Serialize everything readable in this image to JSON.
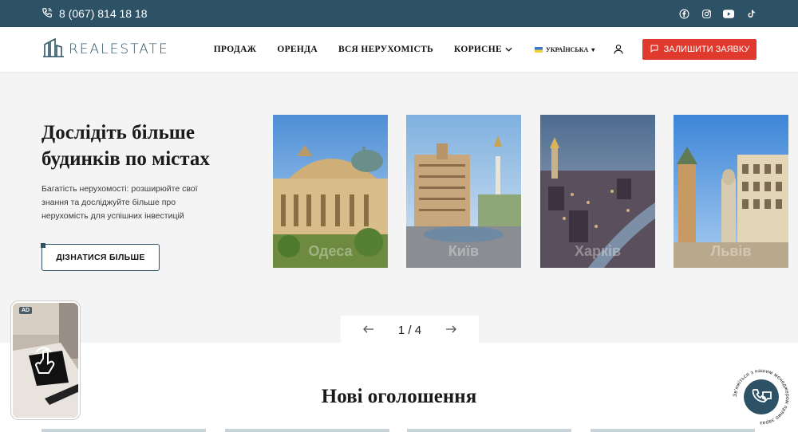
{
  "topbar": {
    "phone": "8 (067) 814 18 18",
    "socials": [
      "facebook-icon",
      "instagram-icon",
      "youtube-icon",
      "tiktok-icon"
    ]
  },
  "header": {
    "logo_text": "REALESTATE",
    "nav": [
      {
        "label": "ПРОДАЖ"
      },
      {
        "label": "ОРЕНДА"
      },
      {
        "label": "ВСЯ НЕРУХОМІСТЬ"
      },
      {
        "label": "КОРИСНЕ"
      }
    ],
    "language": "УКРАЇНСЬКА",
    "cta_label": "ЗАЛИШИТИ ЗАЯВКУ"
  },
  "hero": {
    "title": "Дослідіть більше будинків по містах",
    "description": "Багатість нерухомості: розширюйте свої знання та досліджуйте більше про нерухомість для успішних інвестицій",
    "button_label": "ДІЗНАТИСЯ БІЛЬШЕ",
    "cards": [
      {
        "label": "Одеса"
      },
      {
        "label": "Київ"
      },
      {
        "label": "Харків"
      },
      {
        "label": "Львів"
      }
    ],
    "pager": {
      "text": "1 / 4",
      "current": 1,
      "total": 4
    }
  },
  "listings": {
    "title": "Нові оголошення"
  },
  "ad": {
    "badge": "AD"
  },
  "chat": {
    "circle_text": "Зв'яжіться з нашим менеджером прямо зараз"
  },
  "colors": {
    "topbar": "#2d5265",
    "accent": "#e03a2f",
    "background": "#f4f4f4"
  }
}
